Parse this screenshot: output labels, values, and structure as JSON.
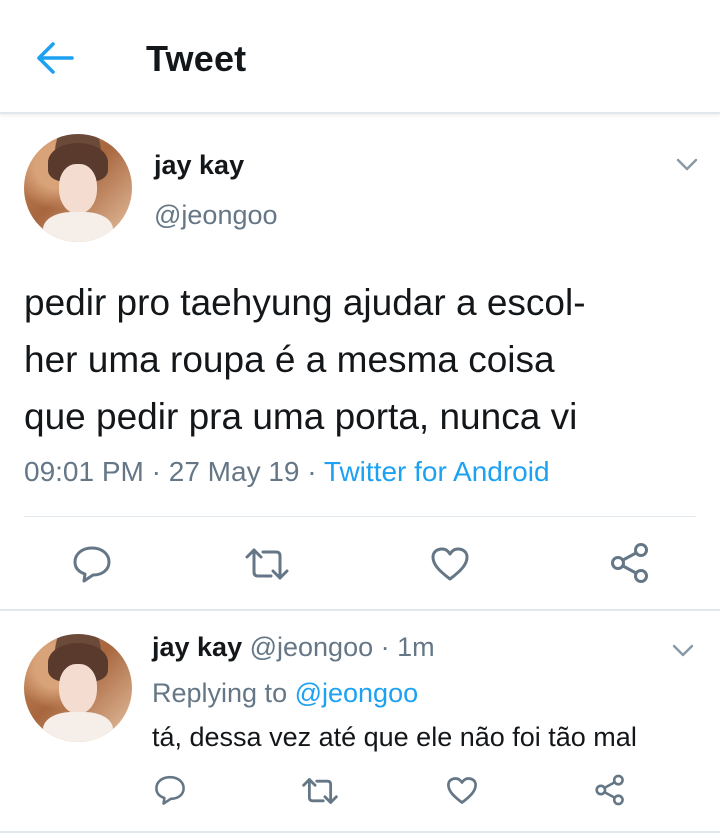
{
  "header": {
    "title": "Tweet",
    "back_icon": "arrow-left-icon",
    "accent": "#1da1f2"
  },
  "tweet": {
    "name": "jay kay",
    "handle": "@jeongoo",
    "text": "pedir pro taehyung ajudar a escol-\nher uma roupa é a mesma coisa\nque pedir pra uma porta, nunca vi",
    "time": "09:01 PM",
    "dot1": " · ",
    "date": "27 May 19",
    "dot2": " · ",
    "source": "Twitter for Android",
    "actions": [
      "reply-icon",
      "retweet-icon",
      "like-icon",
      "share-icon"
    ]
  },
  "reply": {
    "name": "jay kay",
    "handle_time": " @jeongoo · 1m",
    "replying_prefix": "Replying to ",
    "replying_to": "@jeongoo",
    "text": "tá, dessa vez até que ele não foi tão mal",
    "actions": [
      "reply-icon",
      "retweet-icon",
      "like-icon",
      "share-icon"
    ]
  },
  "colors": {
    "text": "#14171a",
    "secondary": "#657786",
    "link": "#1da1f2",
    "divider": "#e1e8ed"
  }
}
